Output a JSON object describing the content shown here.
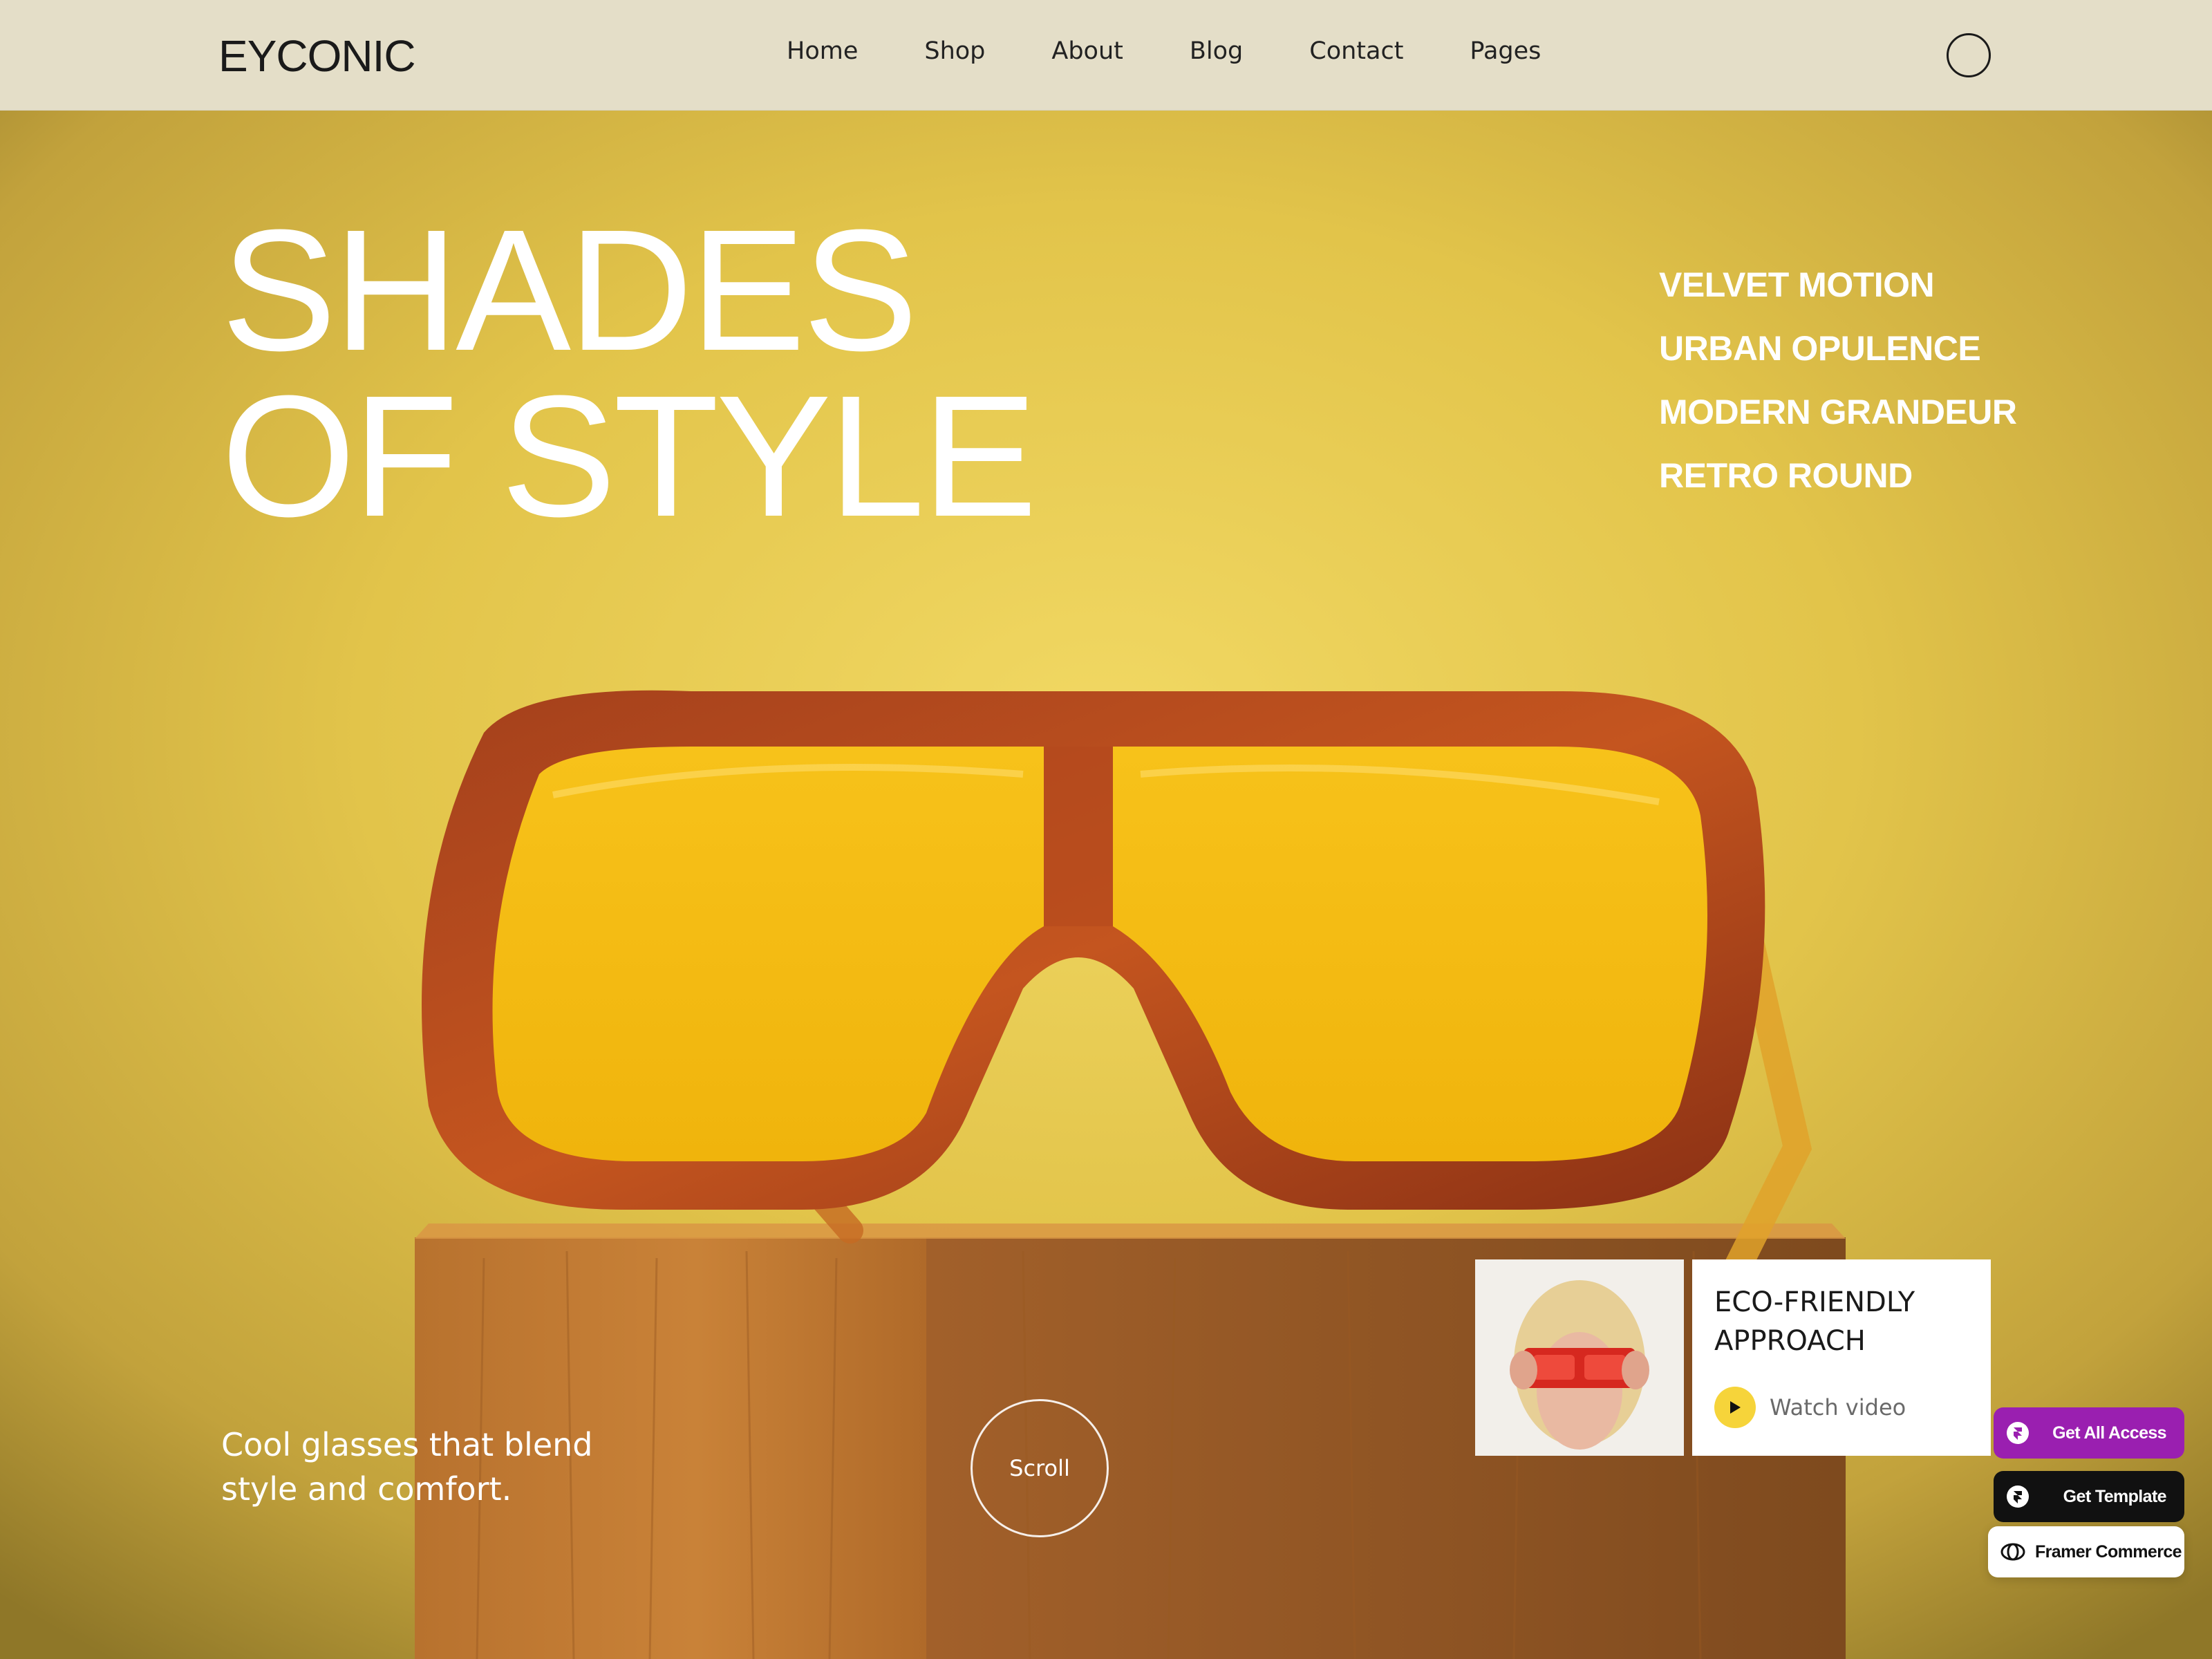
{
  "brand": {
    "logo": "EYCONIC"
  },
  "nav": {
    "links": [
      {
        "label": "Home"
      },
      {
        "label": "Shop"
      },
      {
        "label": "About"
      },
      {
        "label": "Blog"
      },
      {
        "label": "Contact"
      },
      {
        "label": "Pages"
      }
    ]
  },
  "hero": {
    "headline_line1": "SHADES",
    "headline_line2": "OF STYLE",
    "collections": [
      {
        "label": "VELVET MOTION"
      },
      {
        "label": "URBAN OPULENCE"
      },
      {
        "label": "MODERN GRANDEUR"
      },
      {
        "label": "RETRO ROUND"
      }
    ],
    "tagline": "Cool glasses that blend style and comfort.",
    "scroll_label": "Scroll"
  },
  "video_card": {
    "title": "ECO-FRIENDLY APPROACH",
    "watch_label": "Watch video"
  },
  "badges": {
    "access": "Get All Access",
    "template": "Get Template",
    "commerce": "Framer Commerce"
  },
  "colors": {
    "background_yellow": "#e2c44a",
    "nav_bg": "#e4dec8",
    "text_white": "#ffffff",
    "play_yellow": "#f6d43a",
    "badge_purple": "#9a1fb0",
    "badge_black": "#111111"
  },
  "icons": {
    "account": "circle-outline-icon",
    "play": "play-icon",
    "framer": "framer-logo-icon"
  }
}
